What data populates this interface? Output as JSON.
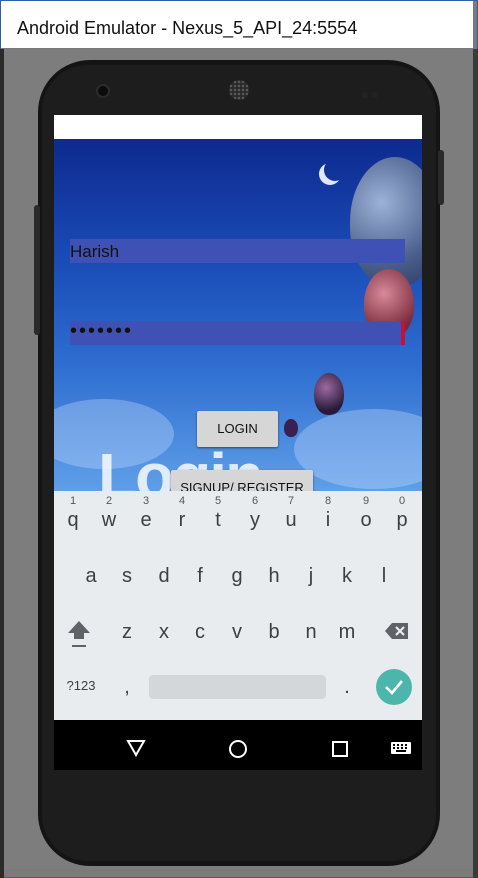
{
  "window": {
    "title": "Android Emulator - Nexus_5_API_24:5554"
  },
  "form": {
    "username_value": "Harish",
    "password_value": "•••••••",
    "login_label": "LOGIN",
    "signup_label": "SIGNUP/ REGISTER",
    "background_text": "Login"
  },
  "keyboard": {
    "row1": [
      "q",
      "w",
      "e",
      "r",
      "t",
      "y",
      "u",
      "i",
      "o",
      "p"
    ],
    "row1_hints": [
      "1",
      "2",
      "3",
      "4",
      "5",
      "6",
      "7",
      "8",
      "9",
      "0"
    ],
    "row2": [
      "a",
      "s",
      "d",
      "f",
      "g",
      "h",
      "j",
      "k",
      "l"
    ],
    "row3": [
      "z",
      "x",
      "c",
      "v",
      "b",
      "n",
      "m"
    ],
    "symbols_label": "?123",
    "comma": ",",
    "period": ".",
    "icons": {
      "shift": "shift-icon",
      "backspace": "backspace-icon",
      "enter": "checkmark-icon"
    }
  },
  "navbar": {
    "icons": [
      "back-icon",
      "home-icon",
      "recents-icon",
      "keyboard-icon"
    ]
  },
  "colors": {
    "field": "#3f51b5",
    "enter": "#4db6ac",
    "titlebar": "#ffffff"
  }
}
